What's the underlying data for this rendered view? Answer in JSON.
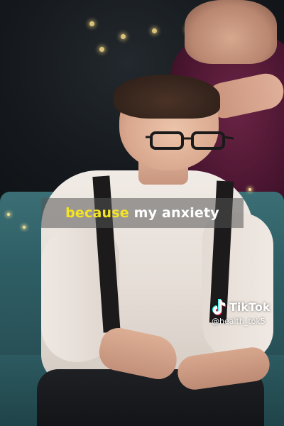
{
  "caption": {
    "highlight_word": "because",
    "rest_text": " my anxiety",
    "highlight_color": "#f5e423",
    "text_color": "#ffffff"
  },
  "watermark": {
    "brand": "TikTok",
    "handle": "@health_tok5",
    "icon": "tiktok-logo-icon"
  }
}
